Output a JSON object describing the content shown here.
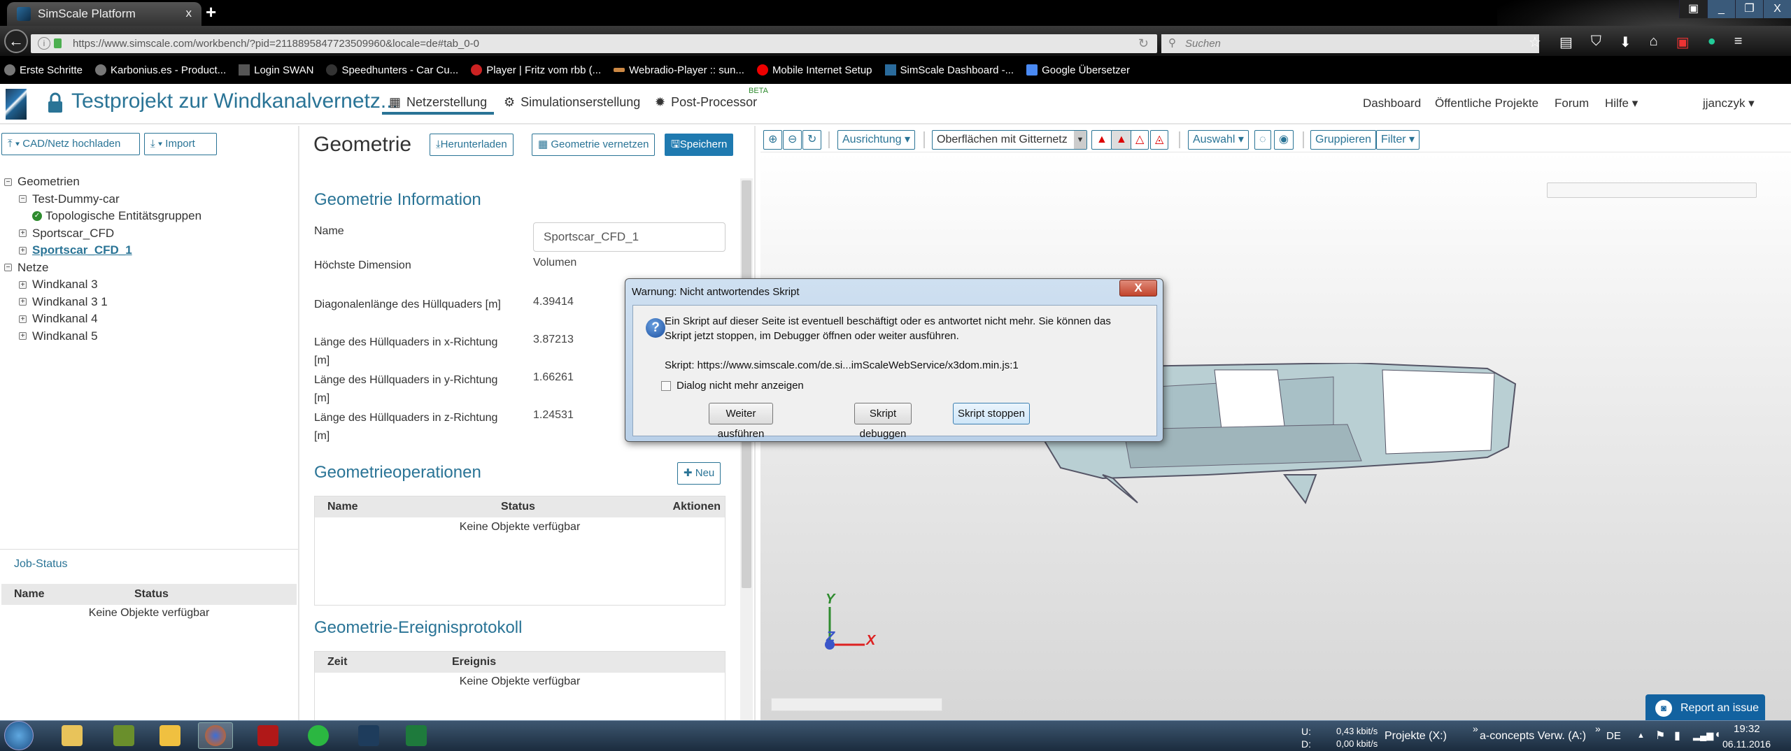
{
  "browser": {
    "tab_title": "SimScale Platform",
    "tab_close": "x",
    "new_tab": "+",
    "url": "https://www.simscale.com/workbench/?pid=2118895847723509960&locale=de#tab_0-0",
    "search_placeholder": "Suchen",
    "window_buttons": [
      "▣",
      "_",
      "❐",
      "X"
    ],
    "bookmarks": [
      "Erste Schritte",
      "Karbonius.es - Product...",
      "Login SWAN",
      "Speedhunters - Car Cu...",
      "Player | Fritz vom rbb (...",
      "Webradio-Player :: sun...",
      "Mobile Internet Setup",
      "SimScale Dashboard -...",
      "Google Übersetzer"
    ]
  },
  "app": {
    "project_title": "Testprojekt zur Windkanalvernetz...",
    "nav": [
      "Netzerstellung",
      "Simulationserstellung",
      "Post-Processor"
    ],
    "beta": "BETA",
    "top_links": [
      "Dashboard",
      "Öffentliche Projekte",
      "Forum",
      "Hilfe ▾"
    ],
    "user": "jjanczyk ▾"
  },
  "left": {
    "upload_button": "▾ CAD/Netz hochladen",
    "import_button": "▾ Import",
    "tree": {
      "geometries_label": "Geometrien",
      "test_dummy": "Test-Dummy-car",
      "topo": "Topologische Entitätsgruppen",
      "sportscar": "Sportscar_CFD",
      "sportscar1": "Sportscar_CFD_1",
      "meshes_label": "Netze",
      "meshes": [
        "Windkanal 3",
        "Windkanal 3 1",
        "Windkanal 4",
        "Windkanal 5"
      ]
    },
    "job_status": {
      "title": "Job-Status",
      "columns": [
        "Name",
        "Status"
      ],
      "empty": "Keine Objekte verfügbar"
    }
  },
  "geometry": {
    "title": "Geometrie",
    "download": "Herunterladen",
    "mesh": "Geometrie vernetzen",
    "save": "Speichern",
    "info_title": "Geometrie Information",
    "fields": {
      "name_label": "Name",
      "name_value": "Sportscar_CFD_1",
      "dim_label": "Höchste Dimension",
      "dim_value": "Volumen",
      "diag_label": "Diagonalenlänge des Hüllquaders [m]",
      "diag_value": "4.39414",
      "x_label": "Länge des Hüllquaders in x-Richtung [m]",
      "x_value": "3.87213",
      "y_label": "Länge des Hüllquaders in y-Richtung [m]",
      "y_value": "1.66261",
      "z_label": "Länge des Hüllquaders in z-Richtung [m]",
      "z_value": "1.24531"
    },
    "ops_title": "Geometrieoperationen",
    "new_button": "Neu",
    "ops_columns": [
      "Name",
      "Status",
      "Aktionen"
    ],
    "ops_empty": "Keine Objekte verfügbar",
    "log_title": "Geometrie-Ereignisprotokoll",
    "log_columns": [
      "Zeit",
      "Ereignis"
    ],
    "log_empty": "Keine Objekte verfügbar"
  },
  "viewer": {
    "orientation": "Ausrichtung ▾",
    "render_mode": "Oberflächen mit Gitternetz",
    "selection": "Auswahl ▾",
    "group": "Gruppieren",
    "filter": "Filter ▾",
    "axes": {
      "y": "Y",
      "z": "Z",
      "x": "X"
    },
    "report": "Report an issue"
  },
  "dialog": {
    "title": "Warnung: Nicht antwortendes Skript",
    "message_1": "Ein Skript auf dieser Seite ist eventuell beschäftigt oder es antwortet nicht mehr. Sie können das",
    "message_2": "Skript jetzt stoppen, im Debugger öffnen oder weiter ausführen.",
    "script": "Skript: https://www.simscale.com/de.si...imScaleWebService/x3dom.min.js:1",
    "checkbox": "Dialog nicht mehr anzeigen",
    "buttons": [
      "Weiter ausführen",
      "Skript debuggen",
      "Skript stoppen"
    ]
  },
  "taskbar": {
    "net_u_label": "U:",
    "net_u": "0,43 kbit/s",
    "net_d_label": "D:",
    "net_d": "0,00 kbit/s",
    "drive1": "Projekte (X:)",
    "drive2": "a-concepts Verw. (A:)",
    "lang": "DE",
    "time": "19:32",
    "date": "06.11.2016"
  }
}
